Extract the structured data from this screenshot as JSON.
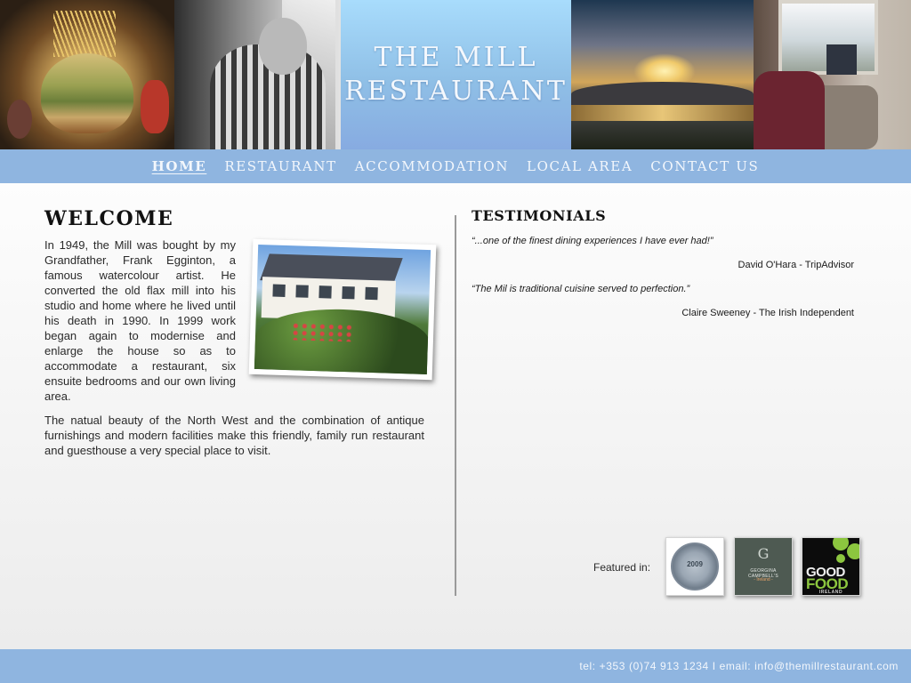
{
  "header": {
    "title_line1": "THE MILL",
    "title_line2": "RESTAURANT"
  },
  "nav": {
    "items": [
      {
        "label": "HOME",
        "active": true
      },
      {
        "label": "RESTAURANT",
        "active": false
      },
      {
        "label": "ACCOMMODATION",
        "active": false
      },
      {
        "label": "LOCAL AREA",
        "active": false
      },
      {
        "label": "CONTACT US",
        "active": false
      }
    ]
  },
  "welcome": {
    "title": "WELCOME",
    "paragraph1": "In 1949, the Mill was bought by my Grandfather, Frank Egginton, a famous watercolour artist. He converted the old flax mill into his studio and home where he lived until his death in 1990. In 1999 work began again to modernise and enlarge the house so as to accommodate a restaurant, six ensuite bedrooms and our own living area.",
    "paragraph2": "The natual beauty of the North West and the combination of antique furnishings and modern facilities make this friendly, family run restaurant and guesthouse a very special place to visit."
  },
  "testimonials": {
    "title": "TESTIMONIALS",
    "items": [
      {
        "quote": "“...one of the finest dining experiences I have ever had!”",
        "author": "David O'Hara - TripAdvisor"
      },
      {
        "quote": "“The Mil is traditional cuisine served to perfection.”",
        "author": "Claire Sweeney - The Irish Independent"
      }
    ]
  },
  "featured": {
    "label": "Featured in:",
    "badges": {
      "bridgestone": {
        "year": "2009"
      },
      "georgina": {
        "letter": "G",
        "name": "GEORGINA CAMPBELL'S",
        "region": "- Ireland -"
      },
      "goodfood": {
        "line1": "GOOD",
        "line2": "FOOD",
        "line3": "IRELAND"
      }
    }
  },
  "footer": {
    "contact": "tel: +353 (0)74 913 1234  I  email: info@themillrestaurant.com"
  },
  "colors": {
    "nav_bar": "#8fb5e0",
    "title_block": "#87abe1",
    "footer_bar": "#8fb5e0",
    "good_food_green": "#8cc63f"
  }
}
